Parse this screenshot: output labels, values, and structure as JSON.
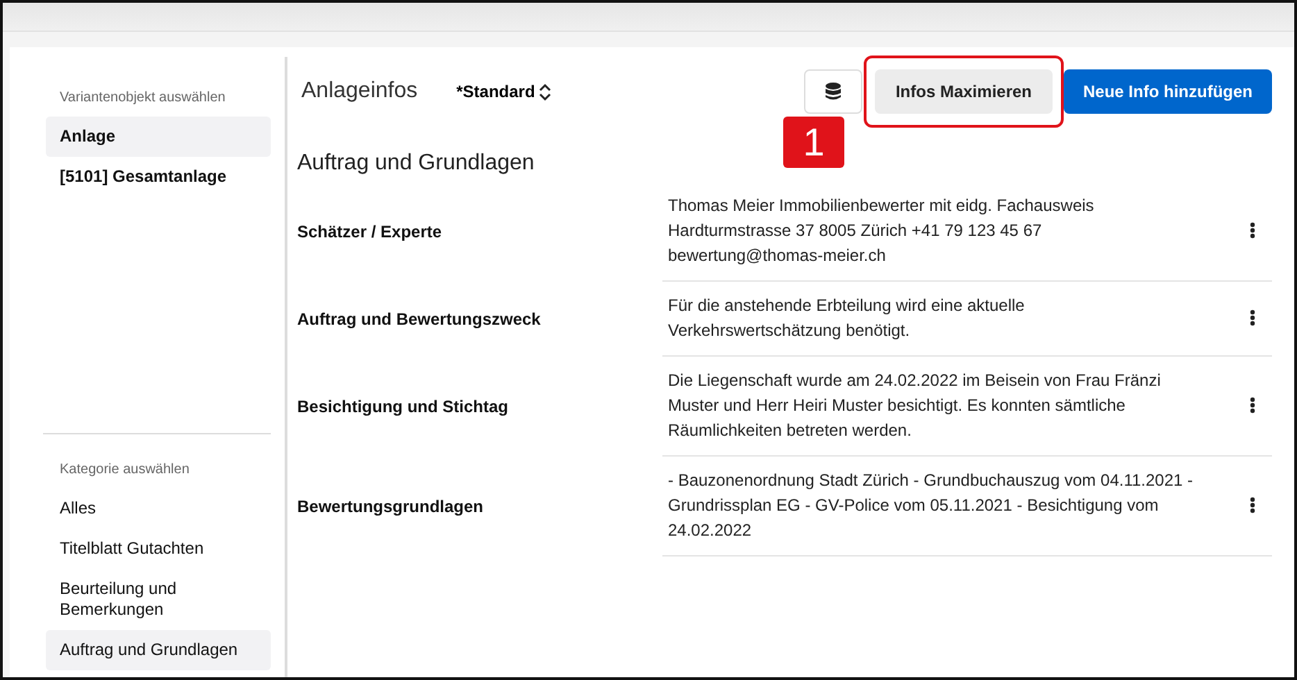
{
  "sidebar": {
    "sections": [
      {
        "label": "Variantenobjekt auswählen",
        "items": [
          {
            "label": "Anlage",
            "selected": true
          },
          {
            "label": "[5101] Gesamtanlage",
            "selected": false
          }
        ]
      },
      {
        "label": "Kategorie auswählen",
        "items": [
          {
            "label": "Alles",
            "selected": false
          },
          {
            "label": "Titelblatt Gutachten",
            "selected": false
          },
          {
            "label": "Beurteilung und Bemerkungen",
            "selected": false
          },
          {
            "label": "Auftrag und Grundlagen",
            "selected": true
          }
        ]
      }
    ]
  },
  "header": {
    "title": "Anlageinfos",
    "variant": "*Standard",
    "buttons": [
      {
        "kind": "icon"
      },
      {
        "kind": "secondary",
        "label": "Infos Maximieren",
        "highlighted": true
      },
      {
        "kind": "primary",
        "label": "Neue Info hinzufügen"
      }
    ],
    "annotation": "1"
  },
  "section": {
    "title": "Auftrag und Grundlagen",
    "rows": [
      {
        "label": "Schätzer / Experte",
        "value": "Thomas Meier Immobilienbewerter mit eidg. Fachausweis Hardturmstrasse 37 8005 Zürich +41 79 123 45 67 bewertung@thomas-meier.ch"
      },
      {
        "label": "Auftrag und Bewertungszweck",
        "value": "Für die anstehende Erbteilung wird eine aktuelle Verkehrswertschätzung benötigt."
      },
      {
        "label": "Besichtigung und Stichtag",
        "value": "Die Liegenschaft wurde am 24.02.2022 im Beisein von Frau Fränzi Muster und Herr Heiri Muster besichtigt. Es konnten sämtliche Räumlichkeiten betreten werden."
      },
      {
        "label": "Bewertungsgrundlagen",
        "value": "- Bauzonenordnung Stadt Zürich - Grundbuchauszug vom 04.11.2021 - Grundrissplan EG - GV-Police vom 05.11.2021 - Besichtigung vom 24.02.2022"
      }
    ]
  }
}
